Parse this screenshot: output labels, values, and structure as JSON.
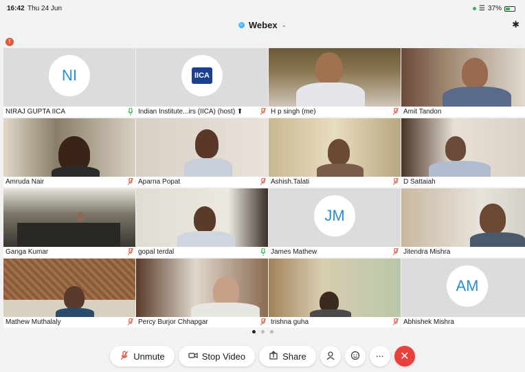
{
  "status": {
    "time": "16:42",
    "date": "Thu 24 Jun",
    "battery": "37%"
  },
  "app": {
    "title": "Webex"
  },
  "tiles": [
    {
      "name": "NIRAJ GUPTA IICA",
      "avatar": "NI",
      "mic": "on"
    },
    {
      "name": "Indian Institute...irs (IICA) (host) ⬆",
      "logo": "IICA",
      "mic": "muted"
    },
    {
      "name": "H p singh (me)",
      "mic": "muted"
    },
    {
      "name": "Amit Tandon",
      "mic": "on"
    },
    {
      "name": "Amruda Nair",
      "mic": "muted"
    },
    {
      "name": "Aparna Popat",
      "mic": "muted"
    },
    {
      "name": "Ashish.Talati",
      "mic": "muted"
    },
    {
      "name": "D Sattaiah",
      "mic": "muted"
    },
    {
      "name": "Ganga Kumar",
      "mic": "muted"
    },
    {
      "name": "gopal terdal",
      "mic": "on"
    },
    {
      "name": "James Mathew",
      "avatar": "JM",
      "mic": "muted"
    },
    {
      "name": "Jitendra Mishra",
      "mic": "on"
    },
    {
      "name": "Mathew Muthalaly",
      "mic": "muted"
    },
    {
      "name": "Percy Burjor Chhapgar",
      "mic": "muted"
    },
    {
      "name": "trishna guha",
      "mic": "muted"
    },
    {
      "name": "Abhishek Mishra",
      "avatar": "AM",
      "mic": "muted"
    }
  ],
  "controls": {
    "unmute": "Unmute",
    "stop_video": "Stop Video",
    "share": "Share"
  },
  "colors": {
    "end_call": "#e8403a",
    "avatar_text": "#2a8fcf",
    "mic_on": "#2db84c",
    "mic_muted": "#e0503a"
  }
}
